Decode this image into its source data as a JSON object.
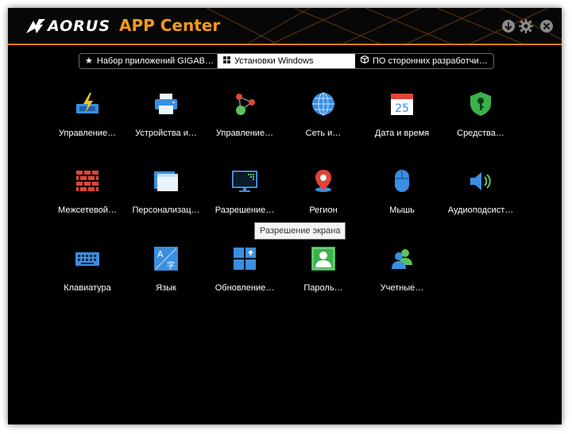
{
  "app": {
    "brand": "AORUS",
    "title": "APP Center"
  },
  "tabs": [
    {
      "label": "Набор приложений GIGAB…",
      "icon": "star-icon"
    },
    {
      "label": "Установки Windows",
      "icon": "windows-icon"
    },
    {
      "label": "ПО сторонних разработчи…",
      "icon": "box-icon"
    }
  ],
  "items": [
    {
      "label": "Управление…",
      "icon": "power-icon"
    },
    {
      "label": "Устройства и…",
      "icon": "printer-icon"
    },
    {
      "label": "Управление…",
      "icon": "network-nodes-icon"
    },
    {
      "label": "Сеть и…",
      "icon": "globe-icon"
    },
    {
      "label": "Дата и время",
      "icon": "calendar-icon",
      "day": "25"
    },
    {
      "label": "Средства…",
      "icon": "shield-key-icon"
    },
    {
      "label": "Межсетевой…",
      "icon": "firewall-icon"
    },
    {
      "label": "Персонализац…",
      "icon": "personalization-icon"
    },
    {
      "label": "Разрешение…",
      "icon": "display-icon"
    },
    {
      "label": "Регион",
      "icon": "location-pin-icon"
    },
    {
      "label": "Мышь",
      "icon": "mouse-icon"
    },
    {
      "label": "Аудиоподсист…",
      "icon": "speaker-icon"
    },
    {
      "label": "Клавиатура",
      "icon": "keyboard-icon"
    },
    {
      "label": "Язык",
      "icon": "language-icon"
    },
    {
      "label": "Обновление…",
      "icon": "windows-update-icon"
    },
    {
      "label": "Пароль…",
      "icon": "user-password-icon"
    },
    {
      "label": "Учетные…",
      "icon": "user-accounts-icon"
    }
  ],
  "tooltip": "Разрешение экрана",
  "colors": {
    "accent": "#e07d10",
    "title": "#f29a1c",
    "icon_blue": "#3b8fe0"
  }
}
